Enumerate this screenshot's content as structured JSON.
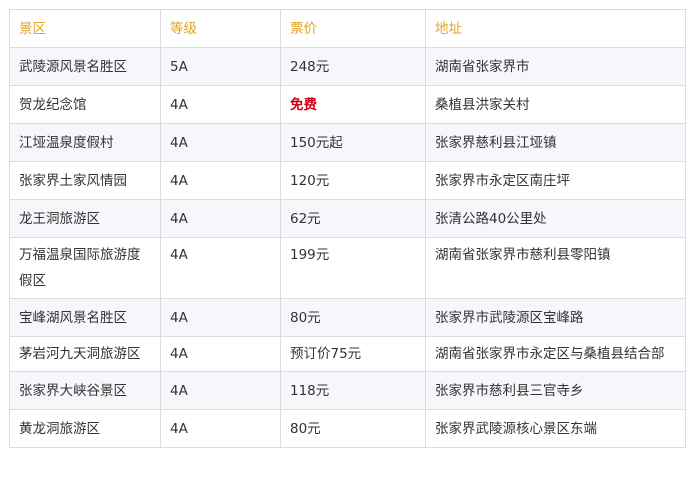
{
  "headers": [
    "景区",
    "等级",
    "票价",
    "地址"
  ],
  "rows": [
    {
      "name": "武陵源风景名胜区",
      "level": "5A",
      "price": "248元",
      "address": "湖南省张家界市"
    },
    {
      "name": "贺龙纪念馆",
      "level": "4A",
      "price": "免费",
      "address": "桑植县洪家关村"
    },
    {
      "name": "江垭温泉度假村",
      "level": "4A",
      "price": "150元起",
      "address": "张家界慈利县江垭镇"
    },
    {
      "name": "张家界土家风情园",
      "level": "4A",
      "price": "120元",
      "address": "张家界市永定区南庄坪"
    },
    {
      "name": "龙王洞旅游区",
      "level": "4A",
      "price": "62元",
      "address": "张清公路40公里处"
    },
    {
      "name": "万福温泉国际旅游度假区",
      "level": "4A",
      "price": "199元",
      "address": "湖南省张家界市慈利县零阳镇"
    },
    {
      "name": "宝峰湖风景名胜区",
      "level": "4A",
      "price": "80元",
      "address": "张家界市武陵源区宝峰路"
    },
    {
      "name": "茅岩河九天洞旅游区",
      "level": "4A",
      "price": "预订价75元",
      "address": "湖南省张家界市永定区与桑植县结合部"
    },
    {
      "name": "张家界大峡谷景区",
      "level": "4A",
      "price": "118元",
      "address": "张家界市慈利县三官寺乡"
    },
    {
      "name": "黄龙洞旅游区",
      "level": "4A",
      "price": "80元",
      "address": "张家界武陵源核心景区东端"
    }
  ],
  "colors": {
    "header_text": "#e0a526",
    "free_text": "#d0021b",
    "stripe": "#f5f7fa",
    "border": "#dcdcdc"
  }
}
